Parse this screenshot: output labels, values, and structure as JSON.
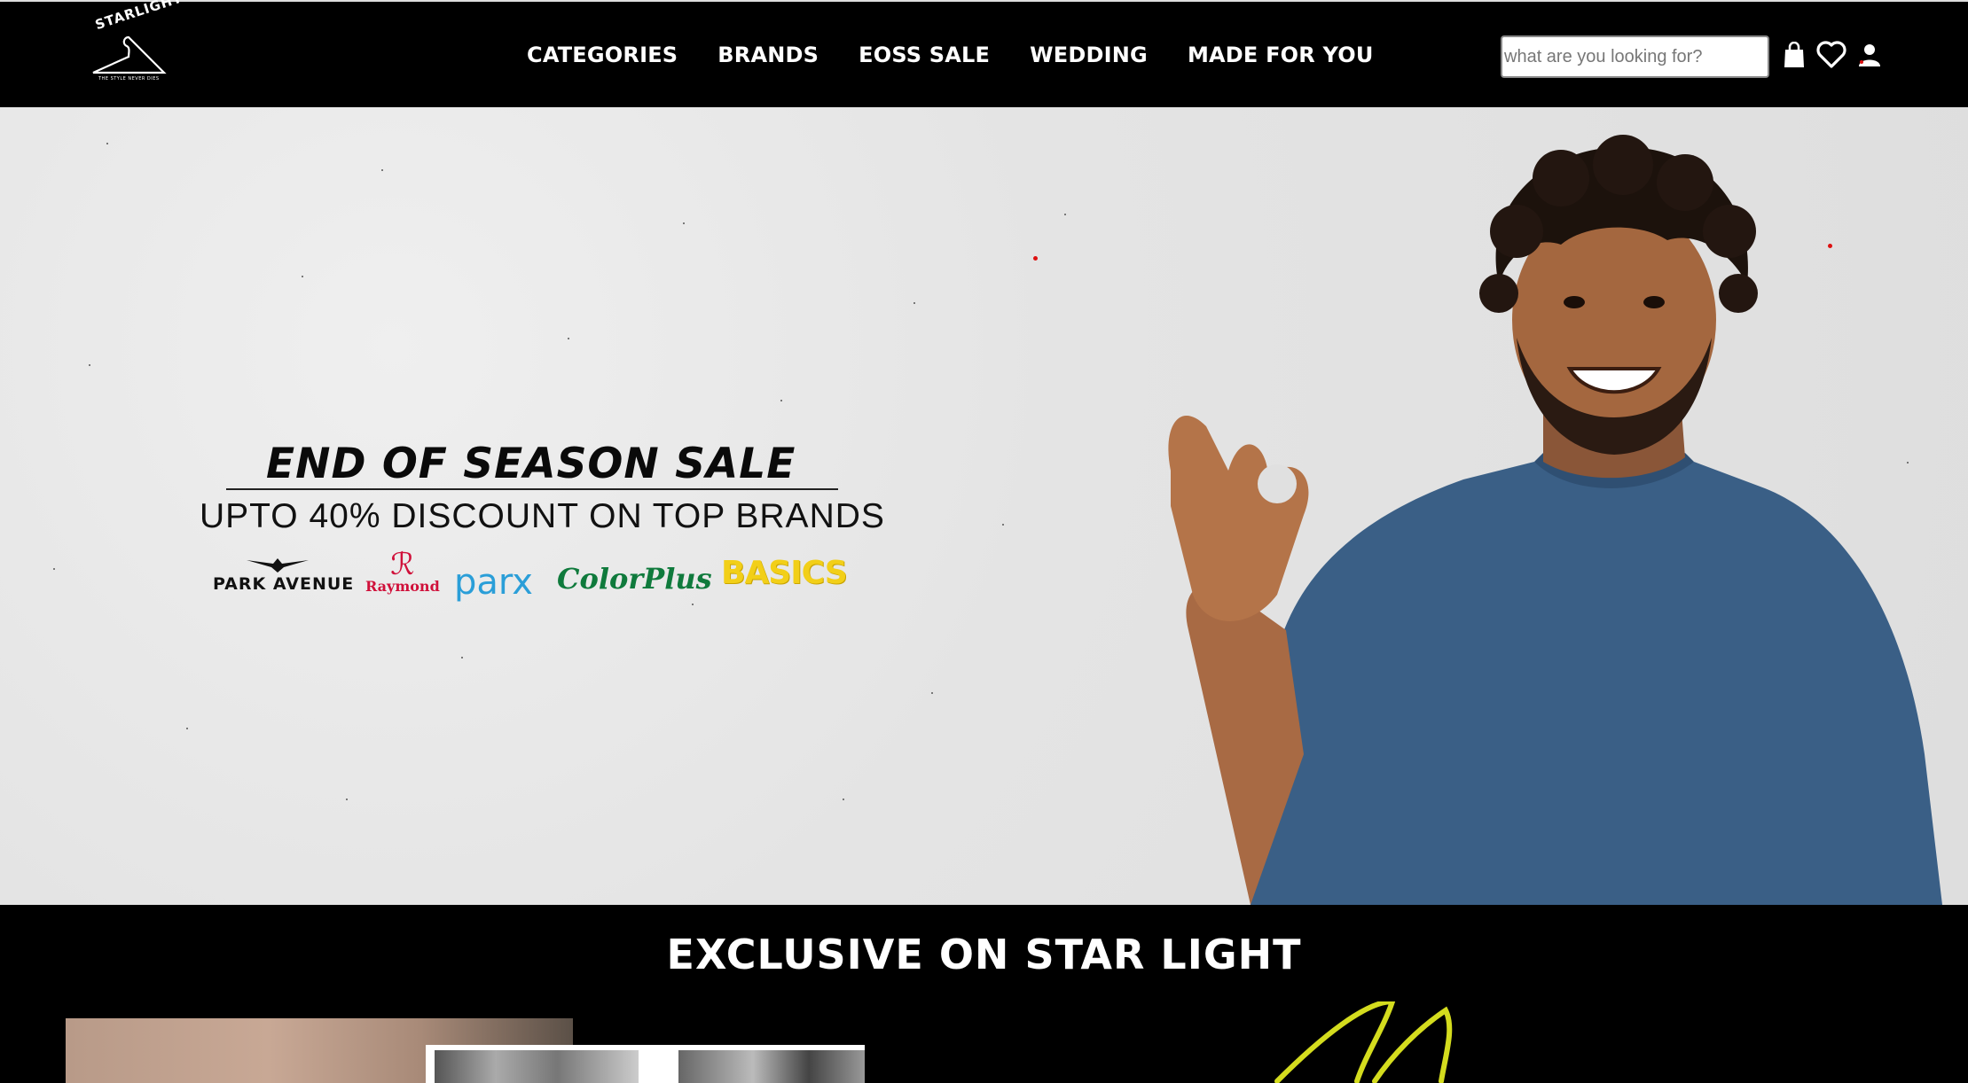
{
  "header": {
    "logo_text": "STARLIGHT",
    "logo_tagline": "THE STYLE NEVER DIES",
    "nav": [
      "CATEGORIES",
      "BRANDS",
      "EOSS SALE",
      "WEDDING",
      "MADE FOR YOU"
    ],
    "search_placeholder": "what are you looking for?",
    "icons": [
      "shopping-bag-icon",
      "heart-icon",
      "user-icon"
    ]
  },
  "hero": {
    "title": "END OF SEASON SALE",
    "subtitle": "UPTO 40% DISCOUNT ON TOP BRANDS",
    "brands": [
      "PARK AVENUE",
      "Raymond",
      "parx",
      "ColorPlus",
      "BASICS"
    ]
  },
  "section": {
    "title": "EXCLUSIVE ON STAR LIGHT"
  },
  "colors": {
    "nav_bg": "#000000",
    "hero_bg": "#e6e6e6",
    "shirt": "#3a5f86",
    "accent_yellow": "#d4dc1e"
  }
}
